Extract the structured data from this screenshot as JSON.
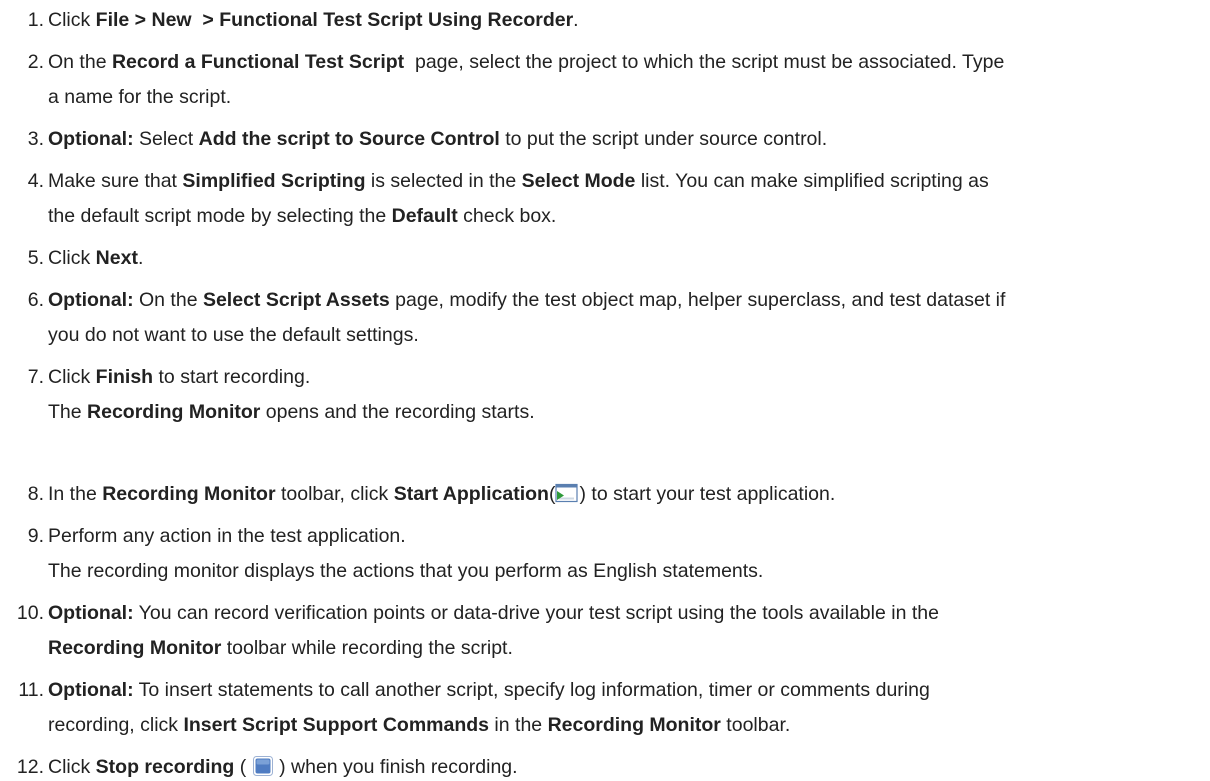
{
  "steps": [
    {
      "number": "1.",
      "lines": [
        [
          {
            "t": "Click "
          },
          {
            "t": "File > New  > Functional Test Script Using Recorder",
            "b": true
          },
          {
            "t": "."
          }
        ]
      ]
    },
    {
      "number": "2.",
      "lines": [
        [
          {
            "t": "On the "
          },
          {
            "t": "Record a Functional Test Script ",
            "b": true
          },
          {
            "t": " page, select the project to which the script must be associated. Type"
          }
        ],
        [
          {
            "t": "a name for the script."
          }
        ]
      ]
    },
    {
      "number": "3.",
      "lines": [
        [
          {
            "t": "Optional:",
            "b": true
          },
          {
            "t": " Select "
          },
          {
            "t": "Add the script to Source Control",
            "b": true
          },
          {
            "t": " to put the script under source control."
          }
        ]
      ]
    },
    {
      "number": "4.",
      "lines": [
        [
          {
            "t": "Make sure that "
          },
          {
            "t": "Simplified Scripting",
            "b": true
          },
          {
            "t": " is selected in the "
          },
          {
            "t": "Select Mode",
            "b": true
          },
          {
            "t": " list. You can make simplified scripting as"
          }
        ],
        [
          {
            "t": "the default script mode by selecting the "
          },
          {
            "t": "Default",
            "b": true
          },
          {
            "t": " check box."
          }
        ]
      ]
    },
    {
      "number": "5.",
      "lines": [
        [
          {
            "t": "Click "
          },
          {
            "t": "Next",
            "b": true
          },
          {
            "t": "."
          }
        ]
      ]
    },
    {
      "number": "6.",
      "lines": [
        [
          {
            "t": "Optional:",
            "b": true
          },
          {
            "t": " On the "
          },
          {
            "t": "Select Script Assets",
            "b": true
          },
          {
            "t": " page, modify the test object map, helper superclass, and test dataset if"
          }
        ],
        [
          {
            "t": "you do not want to use the default settings."
          }
        ]
      ]
    },
    {
      "number": "7.",
      "lines": [
        [
          {
            "t": "Click "
          },
          {
            "t": "Finish",
            "b": true
          },
          {
            "t": " to start recording."
          }
        ],
        [
          {
            "t": "The "
          },
          {
            "t": "Recording Monitor",
            "b": true
          },
          {
            "t": " opens and the recording starts."
          }
        ]
      ]
    },
    {
      "number": "8.",
      "lines": [
        [
          {
            "t": "In the "
          },
          {
            "t": "Recording Monitor",
            "b": true
          },
          {
            "t": " toolbar, click "
          },
          {
            "t": "Start Application",
            "b": true
          },
          {
            "t": "("
          },
          {
            "icon": "start-application-icon"
          },
          {
            "t": ") to start your test application."
          }
        ]
      ]
    },
    {
      "number": "9.",
      "lines": [
        [
          {
            "t": "Perform any action in the test application."
          }
        ],
        [
          {
            "t": "The recording monitor displays the actions that you perform as English statements."
          }
        ]
      ]
    },
    {
      "number": "10.",
      "lines": [
        [
          {
            "t": "Optional:",
            "b": true
          },
          {
            "t": " You can record verification points or data-drive your test script using the tools available in the"
          }
        ],
        [
          {
            "t": "Recording Monitor",
            "b": true
          },
          {
            "t": " toolbar while recording the script."
          }
        ]
      ]
    },
    {
      "number": "11.",
      "lines": [
        [
          {
            "t": "Optional:",
            "b": true
          },
          {
            "t": " To insert statements to call another script, specify log information, timer or comments during"
          }
        ],
        [
          {
            "t": "recording, click "
          },
          {
            "t": "Insert Script Support Commands",
            "b": true
          },
          {
            "t": " in the "
          },
          {
            "t": "Recording Monitor",
            "b": true
          },
          {
            "t": " toolbar."
          }
        ]
      ]
    },
    {
      "number": "12.",
      "lines": [
        [
          {
            "t": "Click "
          },
          {
            "t": "Stop recording",
            "b": true
          },
          {
            "t": " ( "
          },
          {
            "icon": "stop-recording-icon"
          },
          {
            "t": " ) when you finish recording."
          }
        ]
      ]
    }
  ],
  "colors": {
    "text": "#222222",
    "start_icon_frame": "#5a7fb0",
    "start_icon_arrow": "#2e9a3a",
    "stop_icon_fill": "#4f7cc2"
  }
}
